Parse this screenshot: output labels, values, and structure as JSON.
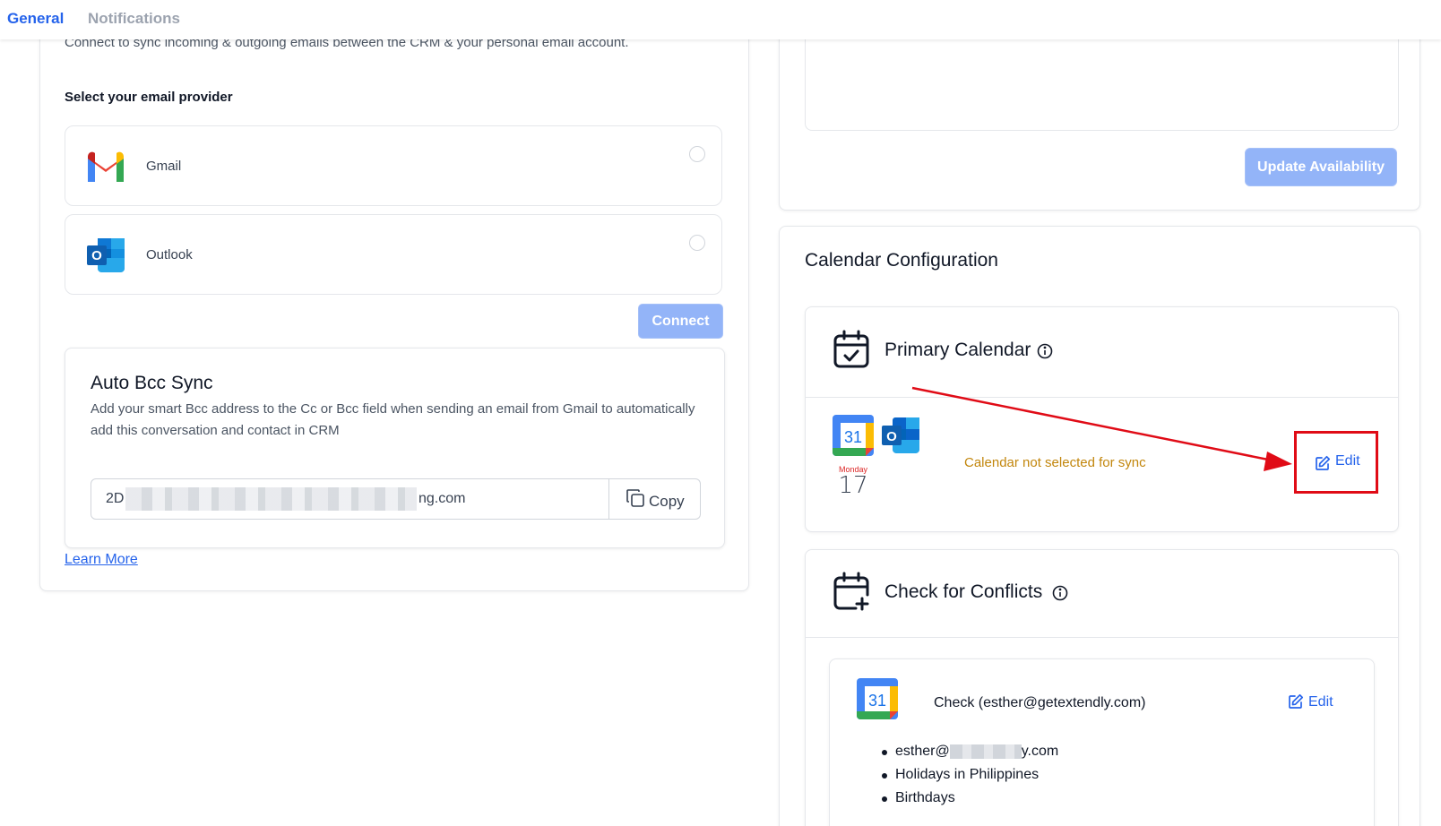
{
  "tabs": {
    "general": "General",
    "notifications": "Notifications"
  },
  "email_sync": {
    "description": "Connect to sync incoming & outgoing emails between the CRM & your personal email account.",
    "select_label": "Select your email provider",
    "providers": [
      {
        "name": "Gmail"
      },
      {
        "name": "Outlook"
      }
    ],
    "connect_label": "Connect"
  },
  "bcc": {
    "title": "Auto Bcc Sync",
    "description": "Add your smart Bcc address to the Cc or Bcc field when sending an email from Gmail to automatically add this conversation and contact in CRM",
    "address_prefix": "2D",
    "address_suffix": "ng.com",
    "copy_label": "Copy"
  },
  "learn_more": "Learn More",
  "availability": {
    "update_label": "Update Availability"
  },
  "calendar_config": {
    "title": "Calendar Configuration",
    "primary": {
      "title": "Primary Calendar",
      "status": "Calendar not selected for sync",
      "edit_label": "Edit",
      "mini_date": {
        "day": "Monday",
        "num": "17"
      },
      "gcal_number": "31"
    },
    "conflicts": {
      "title": "Check for Conflicts",
      "check_label": "Check (esther@getextendly.com)",
      "edit_label": "Edit",
      "gcal_number": "31",
      "items": [
        {
          "prefix": "esther@",
          "suffix": "y.com",
          "masked": true
        },
        {
          "text": "Holidays in Philippines"
        },
        {
          "text": "Birthdays"
        }
      ]
    }
  },
  "colors": {
    "accent": "#2563eb",
    "button_disabled": "#93b4f8",
    "warning_text": "#c2860c",
    "annotation_red": "#e00b16"
  },
  "icons": [
    "gmail-icon",
    "outlook-icon",
    "copy-icon",
    "calendar-check-icon",
    "calendar-plus-icon",
    "info-icon",
    "google-calendar-icon",
    "edit-icon"
  ]
}
